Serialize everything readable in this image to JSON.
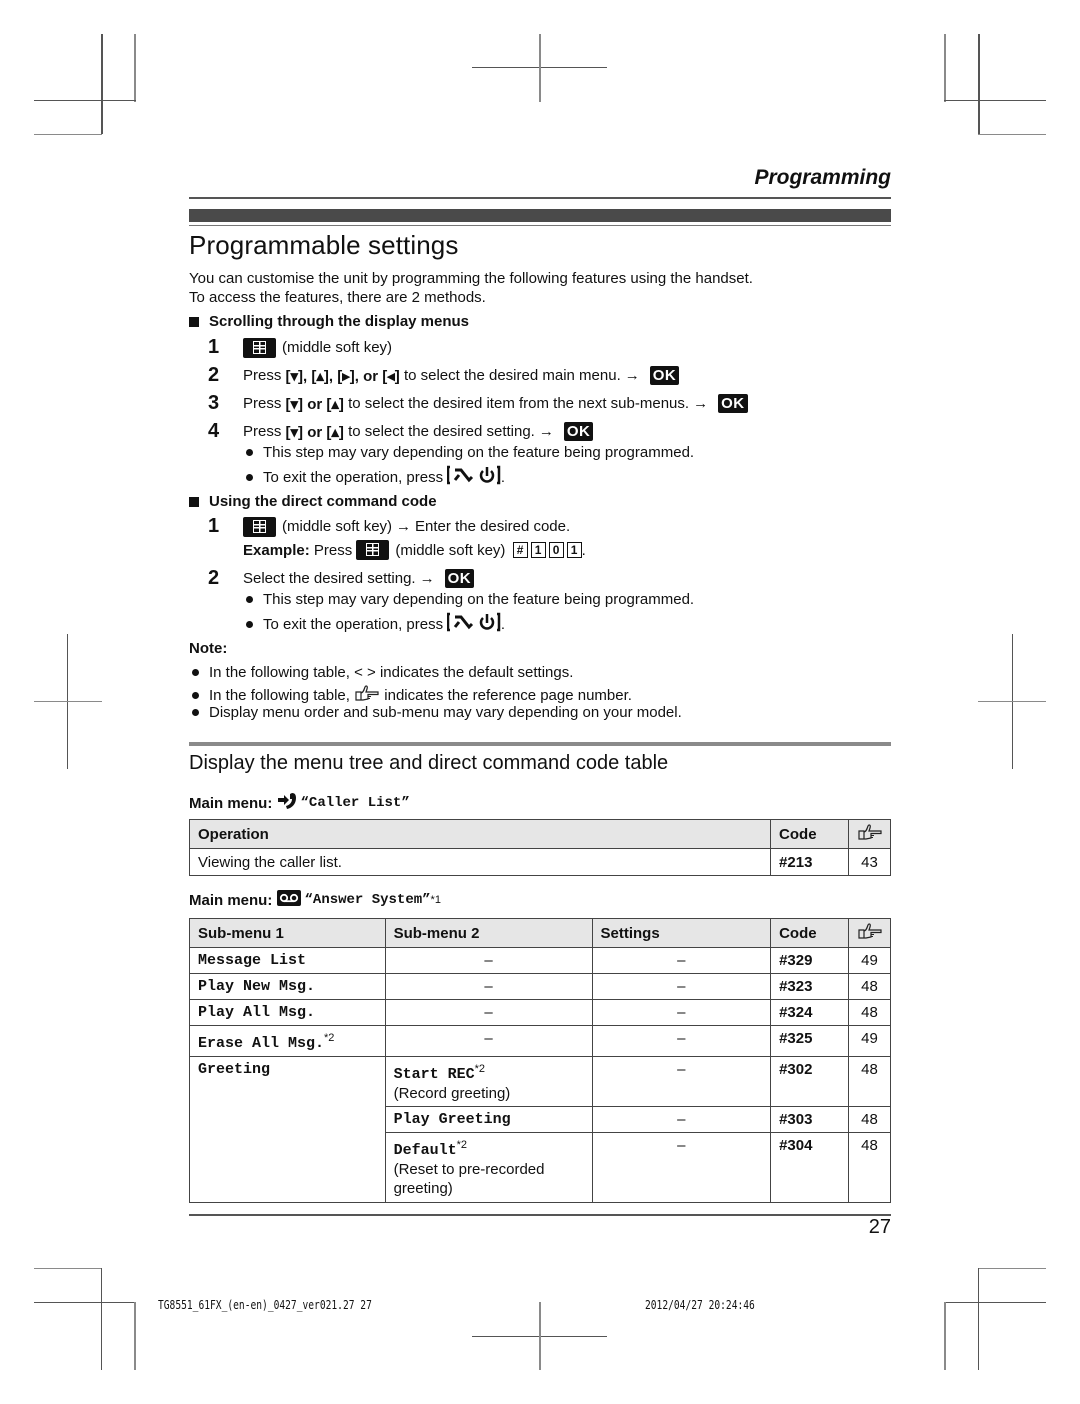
{
  "header": {
    "section": "Programming"
  },
  "title": "Programmable settings",
  "intro": [
    "You can customise the unit by programming the following features using the handset.",
    "To access the features, there are 2 methods."
  ],
  "method1": {
    "heading": "Scrolling through the display menus",
    "steps": [
      {
        "num": "1",
        "text": "(middle soft key)"
      },
      {
        "num": "2",
        "pre": "Press",
        "keys": "[▾], [▴], [▸], or [◂]",
        "text": "to select the desired main menu.",
        "ok": "OK"
      },
      {
        "num": "3",
        "pre": "Press",
        "keys": "[▾] or [▴]",
        "text": "to select the desired item from the next sub-menus.",
        "ok": "OK"
      },
      {
        "num": "4",
        "pre": "Press",
        "keys": "[▾] or [▴]",
        "text": "to select the desired setting.",
        "ok": "OK"
      }
    ],
    "bullets": [
      "This step may vary depending on the feature being programmed.",
      "To exit the operation, press"
    ]
  },
  "method2": {
    "heading": "Using the direct command code",
    "step1": {
      "num": "1",
      "text": "(middle soft key)",
      "text2": "Enter the desired code."
    },
    "example": {
      "label": "Example:",
      "pre": "Press",
      "text": "(middle soft key)",
      "keys": [
        "#",
        "1",
        "0",
        "1"
      ]
    },
    "step2": {
      "num": "2",
      "text": "Select the desired setting.",
      "ok": "OK"
    },
    "bullets": [
      "This step may vary depending on the feature being programmed.",
      "To exit the operation, press"
    ]
  },
  "note": {
    "label": "Note:",
    "items": [
      "In the following table, < > indicates the default settings.",
      "In the following table,",
      "indicates the reference page number.",
      "Display menu order and sub-menu may vary depending on your model."
    ]
  },
  "section2": {
    "title": "Display the menu tree and direct command code table"
  },
  "caller_list": {
    "label": "Main menu:",
    "menu": "“Caller List”",
    "headers": [
      "Operation",
      "Code"
    ],
    "rows": [
      {
        "operation": "Viewing the caller list.",
        "code": "#213",
        "ref": "43"
      }
    ]
  },
  "answer_system": {
    "label": "Main menu:",
    "menu": "“Answer System”",
    "footnote": "*1",
    "headers": [
      "Sub-menu 1",
      "Sub-menu 2",
      "Settings",
      "Code"
    ],
    "rows": [
      {
        "sub1": "Message List",
        "sub2": "–",
        "settings": "–",
        "code": "#329",
        "ref": "49"
      },
      {
        "sub1": "Play New Msg.",
        "sub2": "–",
        "settings": "–",
        "code": "#323",
        "ref": "48"
      },
      {
        "sub1": "Play All Msg.",
        "sub2": "–",
        "settings": "–",
        "code": "#324",
        "ref": "48"
      },
      {
        "sub1": "Erase All Msg.",
        "sub1_note": "*2",
        "sub2": "–",
        "settings": "–",
        "code": "#325",
        "ref": "49"
      },
      {
        "sub1": "Greeting",
        "sub2": "Start REC",
        "sub2_note": "*2",
        "sub2_desc": "(Record greeting)",
        "settings": "–",
        "code": "#302",
        "ref": "48"
      },
      {
        "sub2": "Play Greeting",
        "settings": "–",
        "code": "#303",
        "ref": "48"
      },
      {
        "sub2": "Default",
        "sub2_note": "*2",
        "sub2_desc": "(Reset to pre-recorded greeting)",
        "settings": "–",
        "code": "#304",
        "ref": "48"
      }
    ]
  },
  "page_number": "27",
  "footer": {
    "left": "TG8551_61FX_(en-en)_0427_ver021.27   27",
    "right": "2012/04/27   20:24:46"
  }
}
